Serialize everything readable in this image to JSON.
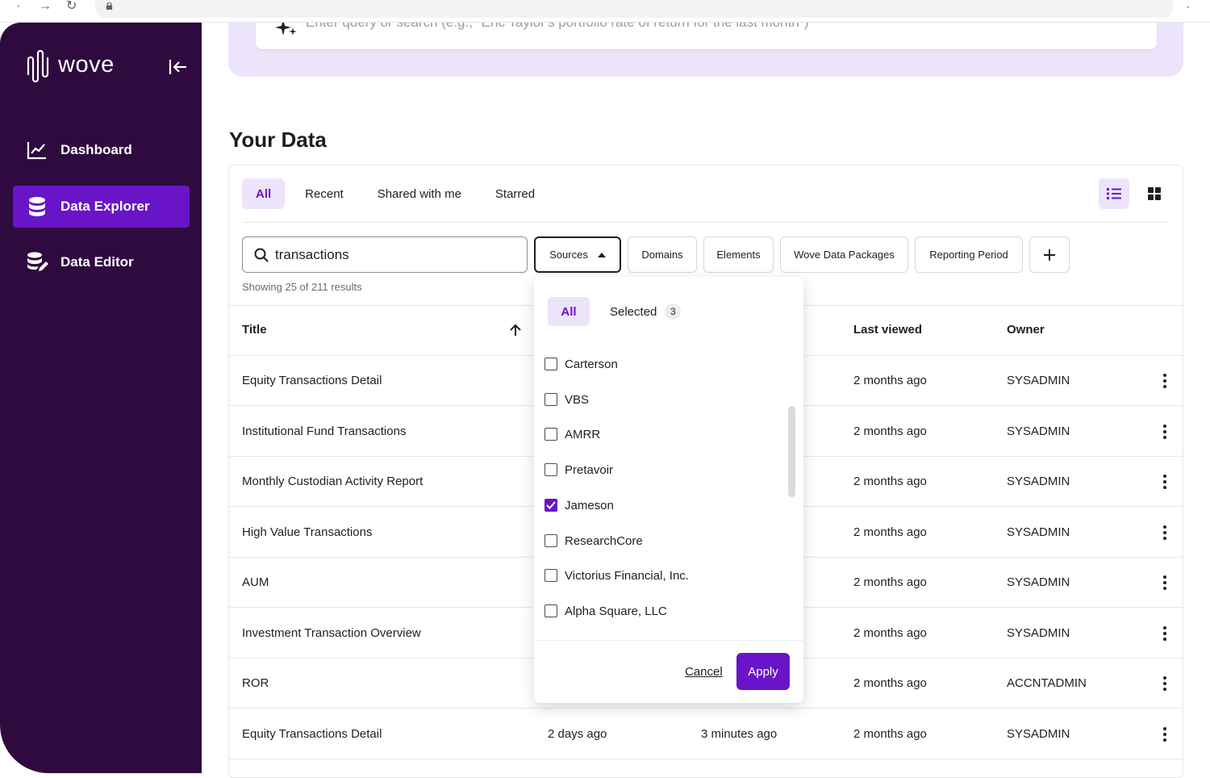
{
  "browser": {
    "back_icon": "back-arrow-icon",
    "forward_icon": "forward-arrow-icon",
    "reload_icon": "reload-icon"
  },
  "sidebar": {
    "logo_text": "wove",
    "items": [
      {
        "label": "Dashboard",
        "icon": "chart-line-icon",
        "active": false
      },
      {
        "label": "Data Explorer",
        "icon": "database-icon",
        "active": true
      },
      {
        "label": "Data Editor",
        "icon": "database-edit-icon",
        "active": false
      }
    ]
  },
  "query": {
    "placeholder": "Enter query or search (e.g., \"Eric Taylor's portfolio rate of return for the last month\")"
  },
  "page": {
    "title": "Your Data"
  },
  "tabs": [
    {
      "label": "All",
      "active": true
    },
    {
      "label": "Recent",
      "active": false
    },
    {
      "label": "Shared with me",
      "active": false
    },
    {
      "label": "Starred",
      "active": false
    }
  ],
  "search": {
    "value": "transactions"
  },
  "filters": {
    "sources": "Sources",
    "domains": "Domains",
    "elements": "Elements",
    "packages": "Wove Data Packages",
    "period": "Reporting Period",
    "add": "+"
  },
  "results": {
    "text": "Showing 25 of 211 results"
  },
  "table": {
    "headers": {
      "title": "Title",
      "last_viewed": "Last viewed",
      "owner": "Owner"
    },
    "rows": [
      {
        "title": "Equity Transactions Detail",
        "created": "",
        "modified": "",
        "last_viewed": "2 months ago",
        "owner": "SYSADMIN"
      },
      {
        "title": "Institutional Fund Transactions",
        "created": "",
        "modified": "",
        "last_viewed": "2 months ago",
        "owner": "SYSADMIN"
      },
      {
        "title": "Monthly Custodian Activity Report",
        "created": "",
        "modified": "",
        "last_viewed": "2 months ago",
        "owner": "SYSADMIN"
      },
      {
        "title": "High Value Transactions",
        "created": "",
        "modified": "",
        "last_viewed": "2 months ago",
        "owner": "SYSADMIN"
      },
      {
        "title": "AUM",
        "created": "",
        "modified": "",
        "last_viewed": "2 months ago",
        "owner": "SYSADMIN"
      },
      {
        "title": "Investment Transaction Overview",
        "created": "",
        "modified": "",
        "last_viewed": "2 months ago",
        "owner": "SYSADMIN"
      },
      {
        "title": "ROR",
        "created": "",
        "modified": "",
        "last_viewed": "2 months ago",
        "owner": "ACCNTADMIN"
      },
      {
        "title": "Equity Transactions Detail",
        "created": "2 days ago",
        "modified": "3 minutes ago",
        "last_viewed": "2 months ago",
        "owner": "SYSADMIN"
      }
    ]
  },
  "sources_dropdown": {
    "tab_all": "All",
    "tab_selected": "Selected",
    "selected_count": "3",
    "options": [
      {
        "label": "Carterson",
        "checked": false
      },
      {
        "label": "VBS",
        "checked": false
      },
      {
        "label": "AMRR",
        "checked": false
      },
      {
        "label": "Pretavoir",
        "checked": false
      },
      {
        "label": "Jameson",
        "checked": true
      },
      {
        "label": "ResearchCore",
        "checked": false
      },
      {
        "label": "Victorius Financial, Inc.",
        "checked": false
      },
      {
        "label": "Alpha Square, LLC",
        "checked": false
      }
    ],
    "cancel": "Cancel",
    "apply": "Apply"
  },
  "colors": {
    "sidebar_bg": "#2e0a3e",
    "accent": "#6a14c9",
    "accent_light": "#ece4fb"
  }
}
